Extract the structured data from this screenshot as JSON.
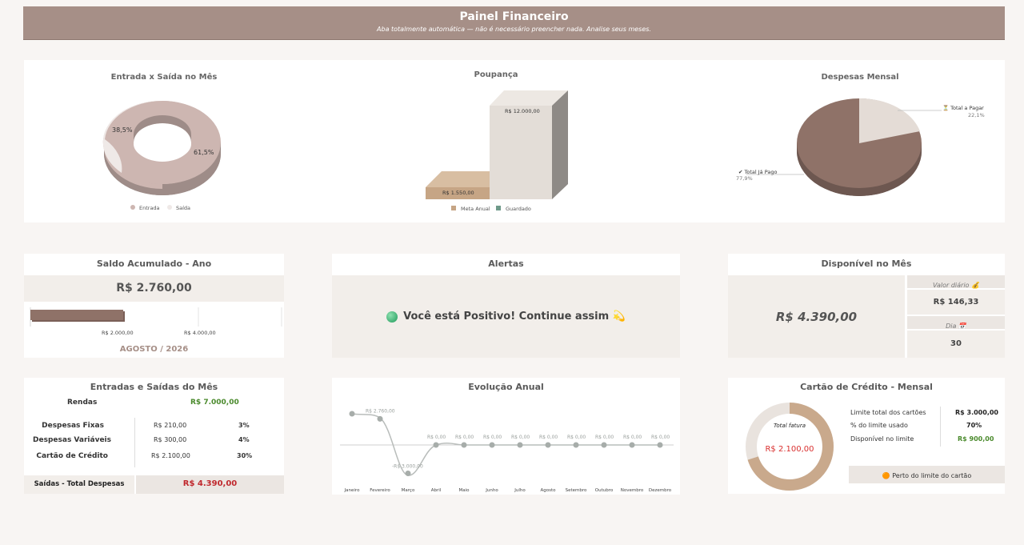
{
  "header": {
    "title": "Painel Financeiro",
    "subtitle": "Aba totalmente automática — não é necessário preencher nada. Analise seus meses."
  },
  "charts": {
    "entrada_saida": {
      "title": "Entrada x Saída no Mês",
      "labels": {
        "saida_pct": "38,5%",
        "entrada_pct": "61,5%"
      },
      "legend": [
        "Entrada",
        "Saída"
      ],
      "colors": {
        "entrada": "#cdb6b1",
        "saida": "#efe9e7"
      }
    },
    "poupanca": {
      "title": "Poupança",
      "labels": {
        "guardado": "R$ 12.000,00",
        "meta": "R$ 1.550,00"
      },
      "legend": [
        "Meta Anual",
        "Guardado"
      ],
      "colors": {
        "meta": "#c9a989",
        "guardado": "#e3ddd7",
        "legend_guardado": "#6f9a8a"
      }
    },
    "despesas": {
      "title": "Despesas Mensal",
      "labels": {
        "pagar": "⏳ Total a Pagar",
        "pagar_pct": "22,1%",
        "pago": "✔ Total Já Pago",
        "pago_pct": "77,9%"
      },
      "colors": {
        "pago": "#8f7268",
        "pagar": "#e4dcd6"
      }
    }
  },
  "chart_data": [
    {
      "type": "pie",
      "title": "Entrada x Saída no Mês",
      "categories": [
        "Entrada",
        "Saída"
      ],
      "values": [
        61.5,
        38.5
      ]
    },
    {
      "type": "bar",
      "title": "Poupança",
      "categories": [
        "Meta Anual",
        "Guardado"
      ],
      "values": [
        1550,
        12000
      ]
    },
    {
      "type": "pie",
      "title": "Despesas Mensal",
      "categories": [
        "Total Já Pago",
        "Total a Pagar"
      ],
      "values": [
        77.9,
        22.1
      ]
    },
    {
      "type": "line",
      "title": "Evolução Anual",
      "x": [
        "Janeiro",
        "Fevereiro",
        "Março",
        "Abril",
        "Maio",
        "Junho",
        "Julho",
        "Agosto",
        "Setembro",
        "Outubro",
        "Novembro",
        "Dezembro"
      ],
      "series": [
        {
          "values": [
            3300,
            2760,
            -3000,
            0,
            0,
            0,
            0,
            0,
            0,
            0,
            0,
            0
          ]
        }
      ]
    },
    {
      "type": "pie",
      "title": "Cartão de Crédito - Mensal",
      "categories": [
        "Total fatura",
        "Disponível no limite"
      ],
      "values": [
        70,
        30
      ]
    }
  ],
  "saldo": {
    "title": "Saldo Acumulado - Ano",
    "value": "R$ 2.760,00",
    "axis_ticks": [
      "R$ 2.000,00",
      "R$ 4.000,00"
    ],
    "bar_value": 2760,
    "axis_max": 6000,
    "period": "AGOSTO / 2026"
  },
  "alertas": {
    "title": "Alertas",
    "message": "Você está Positivo! Continue assim 💫"
  },
  "disponivel": {
    "title": "Disponível no Mês",
    "value": "R$ 4.390,00",
    "valor_diario_label": "Valor diário 💰",
    "valor_diario": "R$ 146,33",
    "dia_label": "Dia 📅",
    "dia": "30"
  },
  "entradas_saidas": {
    "title": "Entradas e Saídas do Mês",
    "rendas_label": "Rendas",
    "rendas_value": "R$ 7.000,00",
    "rows": [
      {
        "label": "Despesas Fixas",
        "value": "R$ 210,00",
        "pct": "3%"
      },
      {
        "label": "Despesas Variáveis",
        "value": "R$ 300,00",
        "pct": "4%"
      },
      {
        "label": "Cartão de Crédito",
        "value": "R$ 2.100,00",
        "pct": "30%"
      }
    ],
    "total_label": "Saídas - Total Despesas",
    "total_value": "R$ 4.390,00"
  },
  "evolucao": {
    "title": "Evolução Anual",
    "months": [
      "Janeiro",
      "Fevereiro",
      "Março",
      "Abril",
      "Maio",
      "Junho",
      "Julho",
      "Agosto",
      "Setembro",
      "Outubro",
      "Novembro",
      "Dezembro"
    ],
    "point_labels": [
      "",
      "R$ 2.760,00",
      "-R$ 3.000,00",
      "R$ 0,00",
      "R$ 0,00",
      "R$ 0,00",
      "R$ 0,00",
      "R$ 0,00",
      "R$ 0,00",
      "R$ 0,00",
      "R$ 0,00",
      "R$ 0,00"
    ]
  },
  "cartao": {
    "title": "Cartão de Crédito - Mensal",
    "donut_label": "Total fatura",
    "donut_value": "R$ 2.100,00",
    "rows": [
      {
        "label": "Limite total dos cartões",
        "value": "R$ 3.000,00"
      },
      {
        "label": "% do limite usado",
        "value": "70%"
      },
      {
        "label": "Disponível no limite",
        "value": "R$ 900,00"
      }
    ],
    "warning": "🟠 Perto do limite do cartão",
    "colors": {
      "used": "#c9a98c",
      "free": "#e9e3de"
    }
  }
}
